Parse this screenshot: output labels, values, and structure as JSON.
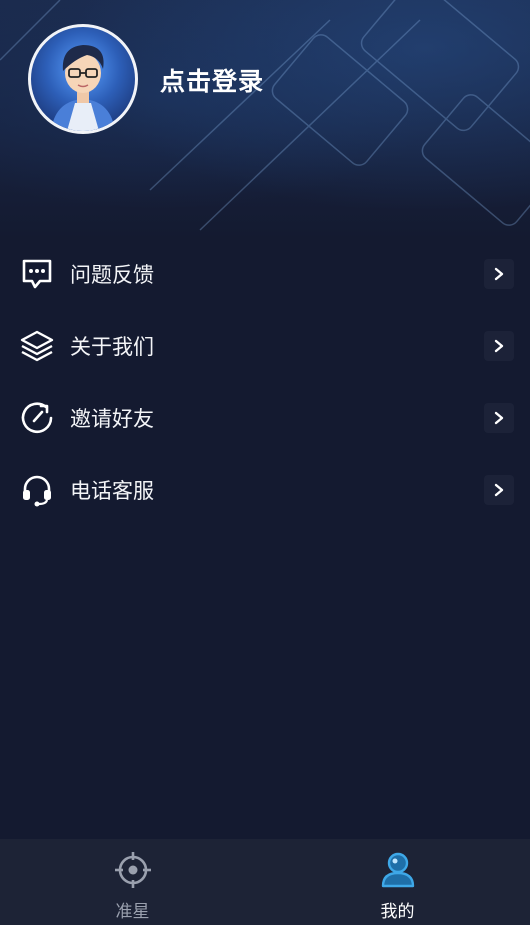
{
  "header": {
    "login_label": "点击登录"
  },
  "menu": {
    "items": [
      {
        "label": "问题反馈",
        "icon": "feedback-chat-icon"
      },
      {
        "label": "关于我们",
        "icon": "layers-icon"
      },
      {
        "label": "邀请好友",
        "icon": "invite-refresh-icon"
      },
      {
        "label": "电话客服",
        "icon": "headset-icon"
      }
    ]
  },
  "tabbar": {
    "tabs": [
      {
        "label": "准星",
        "icon": "crosshair-icon",
        "active": false
      },
      {
        "label": "我的",
        "icon": "user-icon",
        "active": true
      }
    ],
    "active_color": "#3ea8e8",
    "inactive_color": "#9aa0ae"
  }
}
